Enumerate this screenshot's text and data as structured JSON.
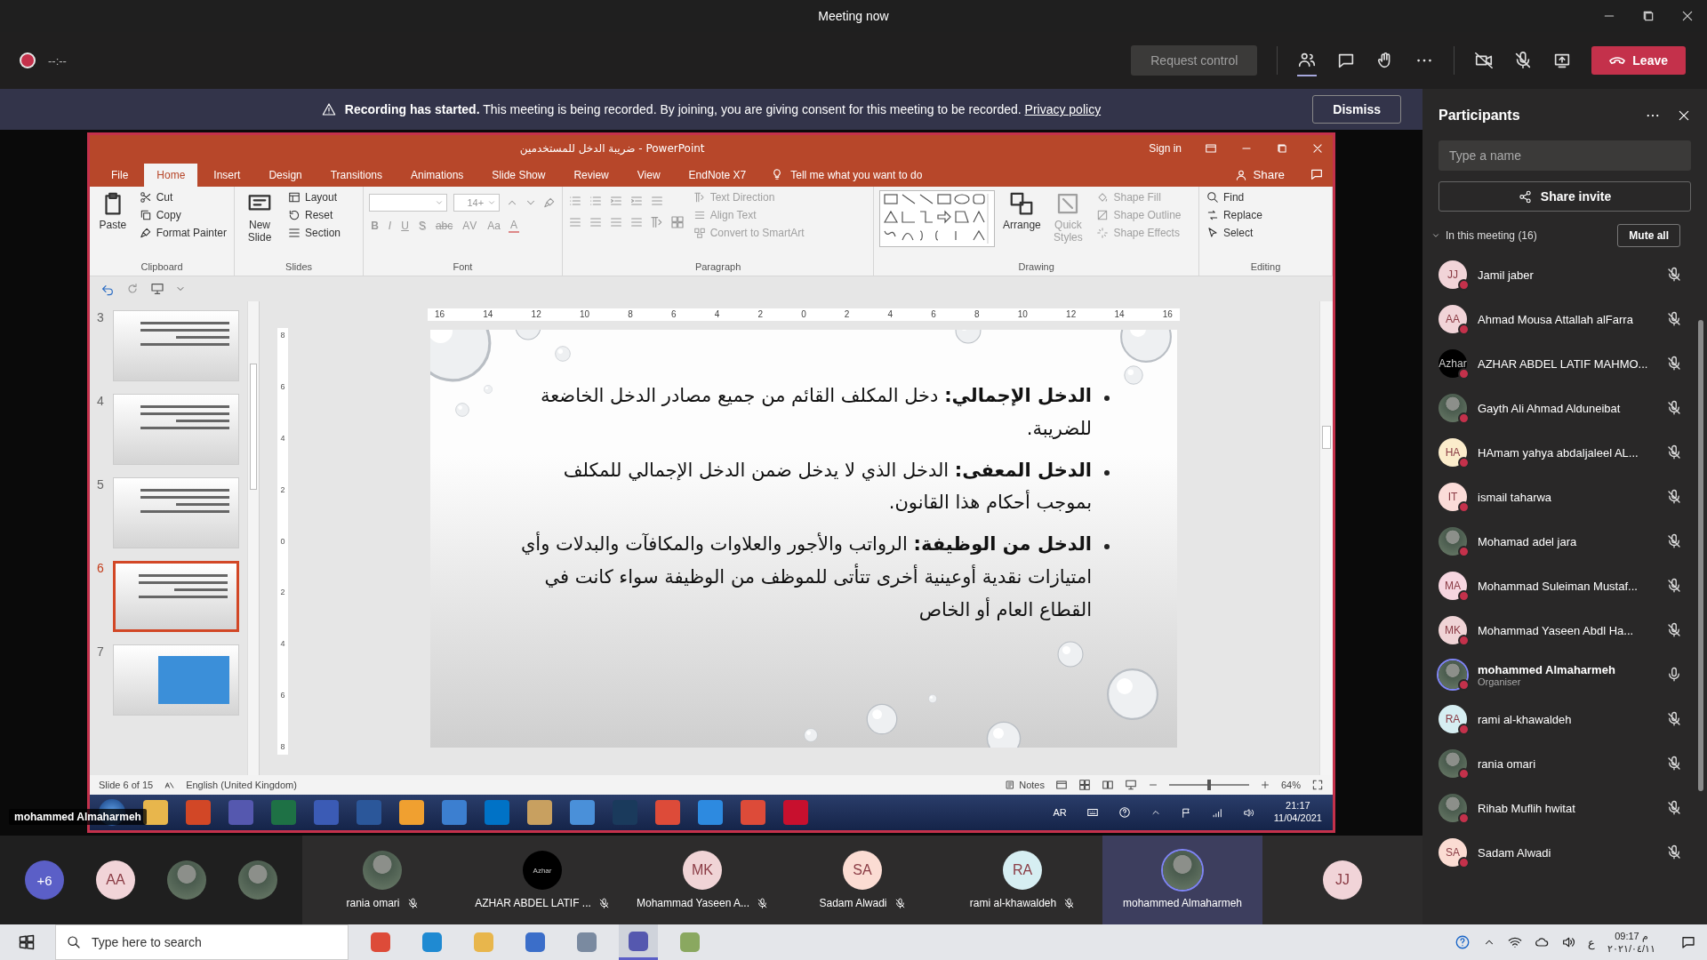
{
  "window": {
    "title": "Meeting now"
  },
  "toolbar": {
    "timer": "--:--",
    "request_control": {
      "label": "Request control",
      "disabled": true
    },
    "leave": "Leave"
  },
  "banner": {
    "message": "**Recording has started.** This meeting is being recorded. By joining, you are giving consent for this meeting to be recorded.",
    "link": "Privacy policy",
    "dismiss": "Dismiss"
  },
  "powerpoint": {
    "title": "ضريبة الدخل للمستخدمين  -  PowerPoint",
    "sign_in": "Sign in",
    "tabs": [
      {
        "label": "File",
        "selected": false
      },
      {
        "label": "Home",
        "selected": true
      },
      {
        "label": "Insert",
        "selected": false
      },
      {
        "label": "Design",
        "selected": false
      },
      {
        "label": "Transitions",
        "selected": false
      },
      {
        "label": "Animations",
        "selected": false
      },
      {
        "label": "Slide Show",
        "selected": false
      },
      {
        "label": "Review",
        "selected": false
      },
      {
        "label": "View",
        "selected": false
      },
      {
        "label": "EndNote X7",
        "selected": false
      }
    ],
    "tell_me": "Tell me what you want to do",
    "share": "Share",
    "ribbon": [
      {
        "kind": "clipboard",
        "label": "Clipboard",
        "large": [
          {
            "label": "Paste",
            "disabled": false
          }
        ],
        "small": [
          {
            "label": "Cut",
            "disabled": false
          },
          {
            "label": "Copy",
            "disabled": false
          },
          {
            "label": "Format Painter",
            "disabled": false
          }
        ]
      },
      {
        "kind": "slides",
        "label": "Slides",
        "large": [
          {
            "label": "New Slide",
            "disabled": false
          }
        ],
        "small": [
          {
            "label": "Layout",
            "disabled": false
          },
          {
            "label": "Reset",
            "disabled": false
          },
          {
            "label": "Section",
            "disabled": false
          }
        ]
      },
      {
        "kind": "font",
        "label": "Font",
        "font_size": "14+",
        "glyphs": [
          {
            "label": "B"
          },
          {
            "label": "I"
          },
          {
            "label": "U"
          },
          {
            "label": "S"
          },
          {
            "label": "abc"
          },
          {
            "label": "AV"
          },
          {
            "label": "Aa"
          },
          {
            "label": "A"
          }
        ]
      },
      {
        "kind": "paragraph",
        "label": "Paragraph",
        "small": [
          {
            "label": "Text Direction",
            "disabled": true
          },
          {
            "label": "Align Text",
            "disabled": true
          },
          {
            "label": "Convert to SmartArt",
            "disabled": true
          }
        ]
      },
      {
        "kind": "drawing",
        "label": "Drawing",
        "large": [
          {
            "label": "Arrange",
            "disabled": false
          },
          {
            "label": "Quick Styles",
            "disabled": true
          }
        ],
        "small": [
          {
            "label": "Shape Fill",
            "disabled": true
          },
          {
            "label": "Shape Outline",
            "disabled": true
          },
          {
            "label": "Shape Effects",
            "disabled": true
          }
        ]
      },
      {
        "kind": "editing",
        "label": "Editing",
        "small": [
          {
            "label": "Find",
            "disabled": false
          },
          {
            "label": "Replace",
            "disabled": false
          },
          {
            "label": "Select",
            "disabled": false
          }
        ]
      }
    ],
    "ruler": [
      "16",
      "14",
      "12",
      "10",
      "8",
      "6",
      "4",
      "2",
      "0",
      "2",
      "4",
      "6",
      "8",
      "10",
      "12",
      "14",
      "16"
    ],
    "vruler": [
      "8",
      "6",
      "4",
      "2",
      "0",
      "2",
      "4",
      "6",
      "8"
    ],
    "thumbnails": [
      {
        "number": "3",
        "kind": "text",
        "selected": false
      },
      {
        "number": "4",
        "kind": "text",
        "selected": false
      },
      {
        "number": "5",
        "kind": "text",
        "selected": false
      },
      {
        "number": "6",
        "kind": "text",
        "selected": true
      },
      {
        "number": "7",
        "kind": "table",
        "selected": false
      }
    ],
    "slide": {
      "bullets": [
        "**الدخل الإجمالي:** دخل المكلف القائم من جميع مصادر الدخل الخاضعة للضريبة.",
        "**الدخل المعفى:** الدخل الذي لا يدخل ضمن الدخل الإجمالي للمكلف بموجب أحكام هذا القانون.",
        "**الدخل من الوظيفة:** الرواتب والأجور والعلاوات والمكافآت والبدلات وأي امتيازات نقدية أوعينية أخرى تتأتى للموظف من الوظيفة سواء كانت في القطاع العام أو الخاص"
      ]
    },
    "status": {
      "slide": "Slide 6 of 15",
      "language": "English (United Kingdom)",
      "notes": "Notes",
      "zoom": "64%",
      "level": 0.5
    },
    "taskbar": {
      "apps": [
        {
          "color": "#e8b64c"
        },
        {
          "color": "#d24726"
        },
        {
          "color": "#5558af"
        },
        {
          "color": "#1e7145"
        },
        {
          "color": "#3b5bb5"
        },
        {
          "color": "#2b579a"
        },
        {
          "color": "#f0a030"
        },
        {
          "color": "#3c7fd0"
        },
        {
          "color": "#0072c6"
        },
        {
          "color": "#c8a060"
        },
        {
          "color": "#4a90d9"
        },
        {
          "color": "#1a3a5c"
        },
        {
          "color": "#dd4b39"
        },
        {
          "color": "#2d8ae0"
        },
        {
          "color": "#dd4b39"
        },
        {
          "color": "#c8102e"
        }
      ],
      "language": "AR",
      "time": "21:17",
      "date": "11/04/2021"
    },
    "presenter": "mohammed Almaharmeh"
  },
  "gallery": {
    "extra": "+6",
    "avatars": [
      {
        "kind": "initials",
        "initials": "AA",
        "color": "#f1d4d8"
      },
      {
        "kind": "photo"
      },
      {
        "kind": "photo"
      }
    ],
    "tiles": [
      {
        "name": "rania omari",
        "kind": "photo",
        "muted": true,
        "speaking": false
      },
      {
        "name": "AZHAR ABDEL LATIF ...",
        "kind": "logo",
        "text": "Azhar",
        "muted": true,
        "speaking": false
      },
      {
        "name": "Mohammad Yaseen A...",
        "kind": "initials",
        "initials": "MK",
        "color": "#f0d4d6",
        "muted": true,
        "speaking": false
      },
      {
        "name": "Sadam Alwadi",
        "kind": "initials",
        "initials": "SA",
        "color": "#fbdcd3",
        "muted": true,
        "speaking": false
      },
      {
        "name": "rami al-khawaldeh",
        "kind": "initials",
        "initials": "RA",
        "color": "#d6eef2",
        "muted": true,
        "speaking": false
      },
      {
        "name": "mohammed Almaharmeh",
        "kind": "photo",
        "muted": false,
        "speaking": true
      },
      {
        "kind": "initials",
        "initials": "JJ",
        "color": "#f1d4d8",
        "muted": false,
        "speaking": false
      }
    ]
  },
  "participants": {
    "title": "Participants",
    "search": {
      "placeholder": "Type a name"
    },
    "share_invite": "Share invite",
    "section": "In this meeting (16)",
    "mute_all": "Mute all",
    "people": [
      {
        "name": "Jamil jaber",
        "kind": "initials",
        "initials": "JJ",
        "color": "#f1d4d8",
        "muted": true
      },
      {
        "name": "Ahmad Mousa Attallah alFarra",
        "kind": "initials",
        "initials": "AA",
        "color": "#f1d4d8",
        "muted": true
      },
      {
        "name": "AZHAR ABDEL LATIF MAHMO...",
        "kind": "logo",
        "text": "Azhar",
        "muted": true
      },
      {
        "name": "Gayth Ali Ahmad Alduneibat",
        "kind": "photo",
        "muted": true
      },
      {
        "name": "HAmam yahya abdaljaleel AL...",
        "kind": "initials",
        "initials": "HA",
        "color": "#fbeccb",
        "muted": true
      },
      {
        "name": "ismail taharwa",
        "kind": "initials",
        "initials": "IT",
        "color": "#fbdcd8",
        "muted": true
      },
      {
        "name": "Mohamad adel jara",
        "kind": "photo",
        "muted": true
      },
      {
        "name": "Mohammad Suleiman Mustaf...",
        "kind": "initials",
        "initials": "MA",
        "color": "#f6d6e0",
        "muted": true
      },
      {
        "name": "Mohammad Yaseen Abdl Ha...",
        "kind": "initials",
        "initials": "MK",
        "color": "#f0d4d6",
        "muted": true
      },
      {
        "name": "mohammed Almaharmeh",
        "role": "Organiser",
        "kind": "photo",
        "muted": false
      },
      {
        "name": "rami al-khawaldeh",
        "kind": "initials",
        "initials": "RA",
        "color": "#d6eef2",
        "muted": true
      },
      {
        "name": "rania omari",
        "kind": "photo",
        "muted": true
      },
      {
        "name": "Rihab Muflih hwitat",
        "kind": "photo",
        "muted": true
      },
      {
        "name": "Sadam Alwadi",
        "kind": "initials",
        "initials": "SA",
        "color": "#fbdcd3",
        "muted": true
      }
    ]
  },
  "taskbar": {
    "search": {
      "placeholder": "Type here to search"
    },
    "apps": [
      {
        "color": "#dd4b39",
        "selected": false
      },
      {
        "color": "#1f8ad2",
        "selected": false
      },
      {
        "color": "#e8b64c",
        "selected": false
      },
      {
        "color": "#3b6ec9",
        "selected": false
      },
      {
        "color": "#7a8aa0",
        "selected": false
      },
      {
        "color": "#5558af",
        "selected": true
      },
      {
        "color": "#8aa860",
        "selected": false
      }
    ],
    "language": "ع",
    "time": "09:17 م",
    "date": "٢٠٢١/٠٤/١١"
  }
}
